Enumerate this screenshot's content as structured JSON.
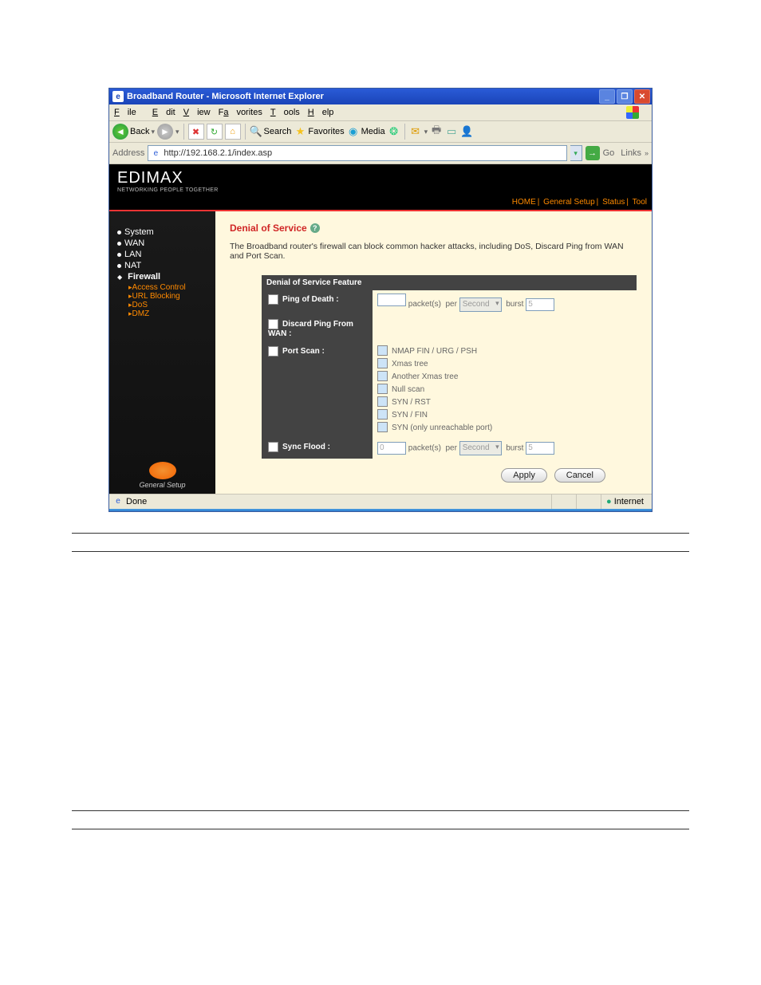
{
  "window": {
    "title": "Broadband Router - Microsoft Internet Explorer"
  },
  "menu": {
    "file": "File",
    "edit": "Edit",
    "view": "View",
    "favorites": "Favorites",
    "tools": "Tools",
    "help": "Help"
  },
  "toolbar": {
    "back": "Back",
    "search": "Search",
    "favorites": "Favorites",
    "media": "Media"
  },
  "address": {
    "label": "Address",
    "value": "http://192.168.2.1/index.asp",
    "go": "Go",
    "links": "Links"
  },
  "brand": {
    "name": "EDIMAX",
    "tagline": "NETWORKING PEOPLE TOGETHER"
  },
  "topnav": {
    "home": "HOME",
    "general": "General Setup",
    "status": "Status",
    "tool": "Tool"
  },
  "sidebar": {
    "items": [
      {
        "label": "System"
      },
      {
        "label": "WAN"
      },
      {
        "label": "LAN"
      },
      {
        "label": "NAT"
      },
      {
        "label": "Firewall"
      }
    ],
    "sub": {
      "access": "Access Control",
      "url": "URL Blocking",
      "dos": "DoS",
      "dmz": "DMZ"
    },
    "footer": "General Setup"
  },
  "content": {
    "title": "Denial of Service",
    "desc": "The Broadband router's firewall can block common hacker attacks, including DoS, Discard Ping from WAN and Port Scan.",
    "tableHeader": "Denial of Service Feature",
    "rows": {
      "ping": "Ping of Death :",
      "discard": "Discard Ping From WAN :",
      "port": "Port Scan :",
      "sync": "Sync Flood :"
    },
    "unitsPackets": "packet(s)",
    "unitsPer": "per",
    "unitsBurst": "burst",
    "selSecond": "Second",
    "burst5": "5",
    "portscanItems": [
      "NMAP FIN / URG / PSH",
      "Xmas tree",
      "Another Xmas tree",
      "Null scan",
      "SYN / RST",
      "SYN / FIN",
      "SYN (only unreachable port)"
    ],
    "apply": "Apply",
    "cancel": "Cancel"
  },
  "statusbar": {
    "done": "Done",
    "zone": "Internet"
  }
}
